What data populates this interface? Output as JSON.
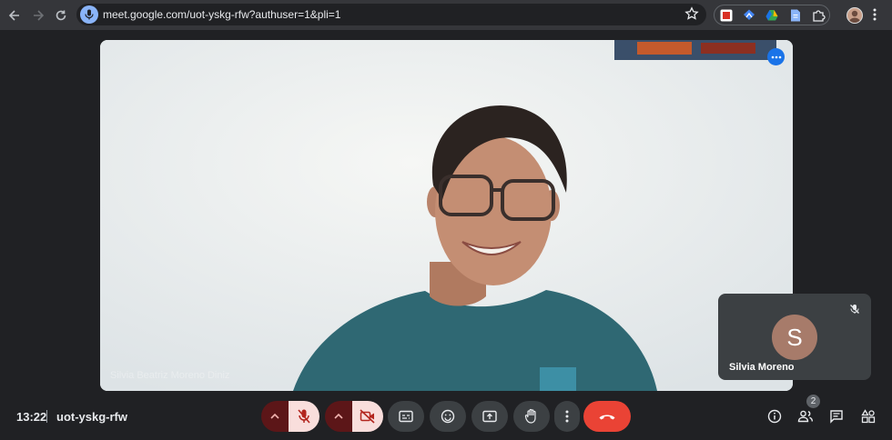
{
  "browser": {
    "url": "meet.google.com/uot-yskg-rfw?authuser=1&pli=1",
    "nav_icons": [
      "back-arrow-icon",
      "forward-arrow-icon",
      "reload-icon"
    ],
    "extensions": [
      "pdf-extension-icon",
      "translate-extension-icon",
      "google-drive-icon",
      "docs-extension-icon",
      "extensions-puzzle-icon"
    ]
  },
  "meeting": {
    "time": "13:22",
    "code": "uot-yskg-rfw",
    "main_participant_name": "Silvia Beatriz Moreno Diniz",
    "tile": {
      "initial": "S",
      "name": "Silvia Moreno",
      "avatar_color": "#a77b6a",
      "muted": true
    },
    "participant_count": "2"
  },
  "controls": {
    "mic_muted": true,
    "camera_off": true,
    "leave_color": "#ea4335",
    "items": [
      "mic-options",
      "mic-toggle",
      "camera-options",
      "camera-toggle",
      "captions",
      "reactions",
      "present-screen",
      "raise-hand",
      "more-options",
      "leave-call"
    ],
    "right_items": [
      "meeting-details",
      "people",
      "chat",
      "activities"
    ]
  },
  "colors": {
    "background": "#202124",
    "toggle_off_bg": "#f9dedc",
    "toggle_off_icon": "#b3261e",
    "accent_blue": "#1a73e8"
  }
}
